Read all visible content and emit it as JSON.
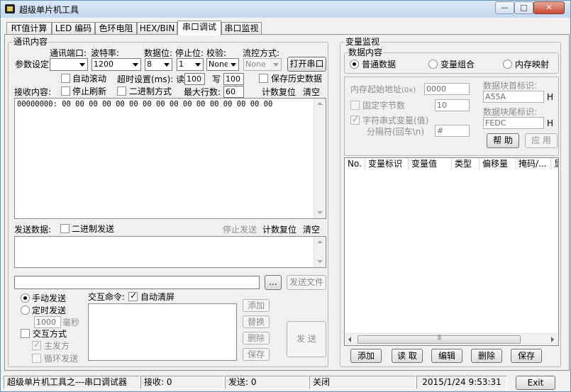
{
  "window": {
    "title": "超级单片机工具"
  },
  "titlebar_buttons": {
    "minimize": "—",
    "maximize": "□",
    "close": "✕"
  },
  "tabs": [
    {
      "label": "RT值计算"
    },
    {
      "label": "LED 编码"
    },
    {
      "label": "色环电阻"
    },
    {
      "label": "HEX/BIN"
    },
    {
      "label": "串口调试"
    },
    {
      "label": "串口监视"
    }
  ],
  "comm": {
    "group_title": "通讯内容",
    "params_label": "参数设定",
    "port_label": "通讯端口:",
    "port_value": "",
    "baud_label": "波特率:",
    "baud_value": "1200",
    "databits_label": "数据位:",
    "databits_value": "8",
    "stopbits_label": "停止位:",
    "stopbits_value": "1",
    "parity_label": "校验:",
    "parity_value": "None",
    "flow_label": "流控方式:",
    "flow_value": "None",
    "open_port_button": "打开串口",
    "auto_scroll": "自动滚动",
    "timeout_label": "超时设置(ms): 读",
    "timeout_read": "100",
    "write_label": "写",
    "timeout_write": "100",
    "save_history": "保存历史数据",
    "receive_label": "接收内容:",
    "stop_refresh": "停止刷新",
    "binary_mode": "二进制方式",
    "max_lines_label": "最大行数:",
    "max_lines": "60",
    "count_reset": "计数复位",
    "clear": "清空",
    "receive_content": "00000000: 00 00 00 00 00 00 00 00 00 00 00 00 00 00 00 00",
    "send_label": "发送数据:",
    "binary_send": "二进制发送",
    "stop_send": "停止发送",
    "send_count_reset": "计数复位",
    "send_clear": "清空",
    "file_path": "",
    "browse_button": "...",
    "send_file_button": "发送文件",
    "manual_send": "手动发送",
    "timed_send": "定时发送",
    "interval_value": "1000",
    "interval_unit": "毫秒",
    "interactive_mode": "交互方式",
    "master_send": "主发方",
    "loop_send": "循环发送",
    "command_label": "交互命令:",
    "auto_clear": "自动清屏",
    "add_button": "添加",
    "replace_button": "替换",
    "delete_button": "删除",
    "save_button": "保存",
    "send_button": "发 送"
  },
  "monitor": {
    "group_title": "变量监视",
    "data_group_title": "数据内容",
    "normal_data": "普通数据",
    "var_combo": "变量组合",
    "mem_map": "内存映射",
    "mem_start_label": "内存起始地址",
    "mem_start_unit": "(0x)",
    "mem_start_value": "0000",
    "fixed_bytes_label": "固定字节数",
    "fixed_bytes_value": "10",
    "string_var_label": "字符串式变量(值)",
    "separator_label": "分隔符(回车\\n)",
    "separator_value": "#",
    "head_label": "数据块首标识:",
    "head_value": "A55A",
    "head_unit": "H",
    "tail_label": "数据块尾标识:",
    "tail_value": "FEDC",
    "tail_unit": "H",
    "help_button": "帮 助",
    "apply_button": "应 用",
    "columns": [
      "No.",
      "变量标识",
      "变量值",
      "类型",
      "偏移量",
      "掩码/...",
      "显"
    ],
    "buttons": [
      "添加",
      "读 取",
      "编辑",
      "删除",
      "保存"
    ]
  },
  "status": {
    "app": "超级单片机工具之---串口调试器",
    "recv": "接收: 0",
    "send": "发送: 0",
    "port_state": "关闭",
    "datetime": "2015/1/24 9:53:31",
    "exit_button": "Exit"
  }
}
